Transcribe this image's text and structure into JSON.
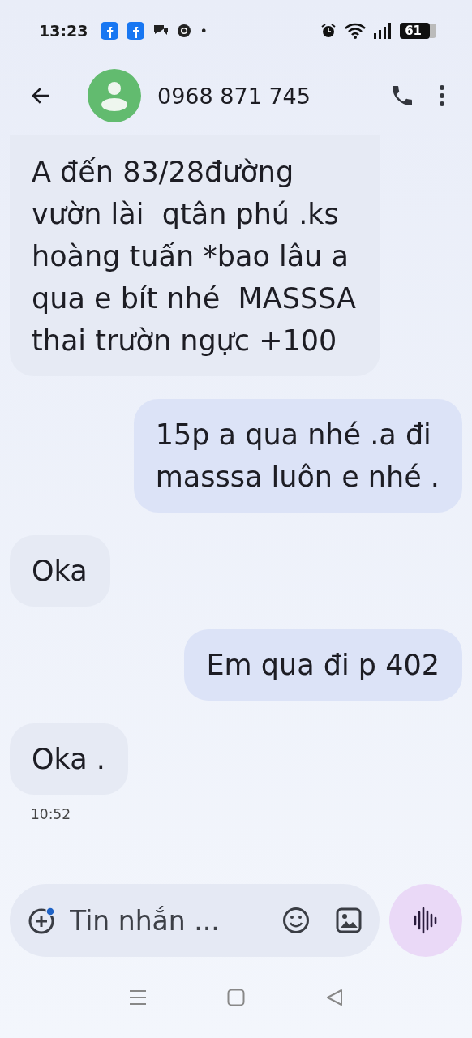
{
  "status_bar": {
    "time": "13:23",
    "more": "•",
    "battery": "61"
  },
  "header": {
    "contact": "0968 871 745"
  },
  "messages": [
    {
      "kind": "incoming",
      "text": "A đến 83/28đường\nvườn lài  qtân phú .ks\nhoàng tuấn *bao lâu a\nqua e bít nhé  MASSSA\nthai trườn ngực +100"
    },
    {
      "kind": "outgoing",
      "text": "15p a qua nhé .a đi\nmasssa luôn e nhé ."
    },
    {
      "kind": "incoming",
      "text": "Oka"
    },
    {
      "kind": "outgoing",
      "text": "Em qua đi p 402"
    },
    {
      "kind": "incoming",
      "text": "Oka ."
    }
  ],
  "timestamp": "10:52",
  "composer": {
    "placeholder": "Tin nhắn ..."
  }
}
